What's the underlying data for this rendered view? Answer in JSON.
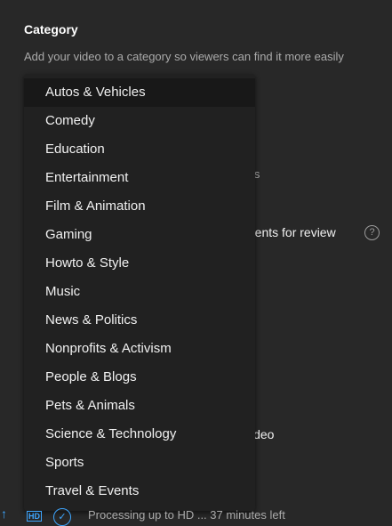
{
  "category": {
    "title": "Category",
    "description": "Add your video to a category so viewers can find it more easily"
  },
  "background": {
    "comments_fragment": "nts",
    "review_fragment": "ments for review",
    "video_fragment": "video",
    "help_icon": "help-circle-icon"
  },
  "dropdown": {
    "hovered_index": 0,
    "items": [
      "Autos & Vehicles",
      "Comedy",
      "Education",
      "Entertainment",
      "Film & Animation",
      "Gaming",
      "Howto & Style",
      "Music",
      "News & Politics",
      "Nonprofits & Activism",
      "People & Blogs",
      "Pets & Animals",
      "Science & Technology",
      "Sports",
      "Travel & Events"
    ]
  },
  "status_bar": {
    "upload_icon": "upload-arrow-icon",
    "hd_icon": "hd-icon",
    "hd_label": "HD",
    "check_icon": "check-circle-icon",
    "processing_text": "Processing up to HD ... 37 minutes left"
  },
  "colors": {
    "background": "#282828",
    "dropdown_bg": "#212121",
    "hover_bg": "#181818",
    "accent": "#3ea6ff"
  }
}
